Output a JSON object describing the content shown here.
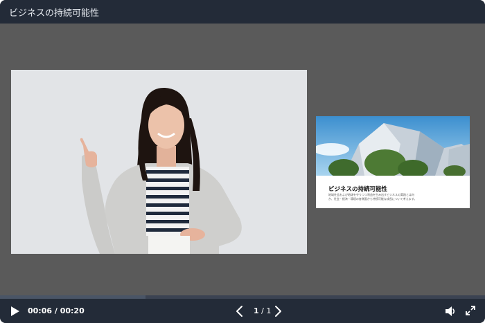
{
  "window": {
    "title": "ビジネスの持続可能性"
  },
  "slide": {
    "title": "ビジネスの持続可能性",
    "body": "地域社会および地球を守りつつ利益を生み出すビジネスの実践とは何か、社会・経済・環境の各側面から持続可能な成長について考えます。"
  },
  "player": {
    "current_time": "00:06",
    "separator": " / ",
    "duration": "00:20",
    "page_current": "1",
    "page_separator": " / ",
    "page_total": "1",
    "progress": 0.3
  },
  "icons": {
    "play": "play-icon",
    "prev": "chevron-left-icon",
    "next": "chevron-right-icon",
    "volume": "volume-icon",
    "fullscreen": "fullscreen-icon"
  },
  "colors": {
    "titlebar": "#232b38",
    "stage": "#5a5a5a",
    "controls": "#232b38"
  }
}
